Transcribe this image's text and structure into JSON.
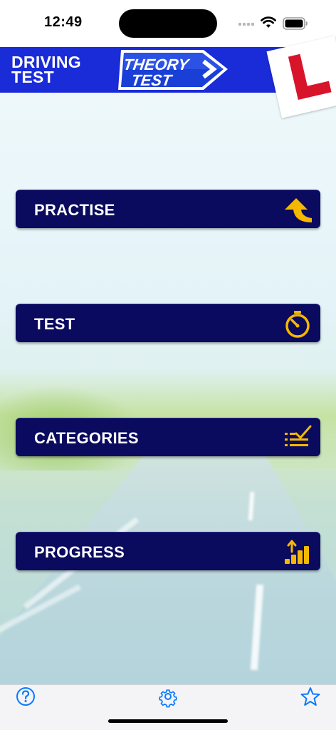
{
  "status": {
    "time": "12:49"
  },
  "header": {
    "title_line1": "DRIVING",
    "title_line2": "TEST",
    "logo_line1": "THEORY",
    "logo_line2": "TEST"
  },
  "menu": [
    {
      "label": "PRACTISE",
      "icon": "arrow-up-icon"
    },
    {
      "label": "TEST",
      "icon": "stopwatch-icon"
    },
    {
      "label": "CATEGORIES",
      "icon": "checklist-icon"
    },
    {
      "label": "PROGRESS",
      "icon": "progress-bars-icon"
    }
  ],
  "tabs": [
    {
      "icon": "help-icon"
    },
    {
      "icon": "settings-gear-icon"
    },
    {
      "icon": "star-icon"
    }
  ],
  "colors": {
    "header_blue": "#1a2bd8",
    "button_navy": "#0a0a5e",
    "icon_yellow": "#f5b800",
    "tab_blue": "#0a7aff",
    "l_plate_red": "#d8142a"
  }
}
